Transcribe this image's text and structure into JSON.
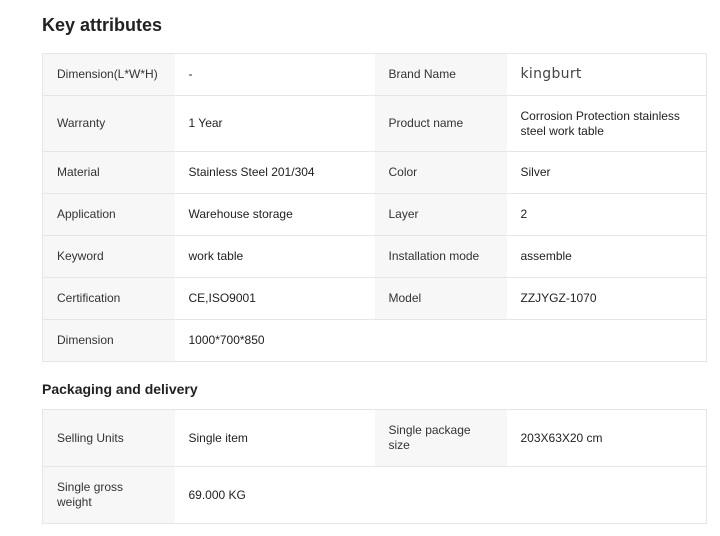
{
  "key_attributes": {
    "title": "Key attributes",
    "rows": [
      {
        "k1": "Dimension(L*W*H)",
        "v1": "-",
        "k2": "Brand Name",
        "v2": "kingburt"
      },
      {
        "k1": "Warranty",
        "v1": "1 Year",
        "k2": "Product name",
        "v2": "Corrosion Protection stainless steel work table"
      },
      {
        "k1": "Material",
        "v1": "Stainless Steel 201/304",
        "k2": "Color",
        "v2": "Silver"
      },
      {
        "k1": "Application",
        "v1": "Warehouse storage",
        "k2": "Layer",
        "v2": "2"
      },
      {
        "k1": "Keyword",
        "v1": "work table",
        "k2": "Installation mode",
        "v2": "assemble"
      },
      {
        "k1": "Certification",
        "v1": "CE,ISO9001",
        "k2": "Model",
        "v2": "ZZJYGZ-1070"
      },
      {
        "k1": "Dimension",
        "v1": "1000*700*850",
        "k2": "",
        "v2": ""
      }
    ]
  },
  "packaging": {
    "title": "Packaging and delivery",
    "rows": [
      {
        "k1": "Selling Units",
        "v1": "Single item",
        "k2": "Single package size",
        "v2": "203X63X20 cm"
      },
      {
        "k1": "Single gross weight",
        "v1": "69.000 KG",
        "k2": "",
        "v2": ""
      }
    ]
  }
}
